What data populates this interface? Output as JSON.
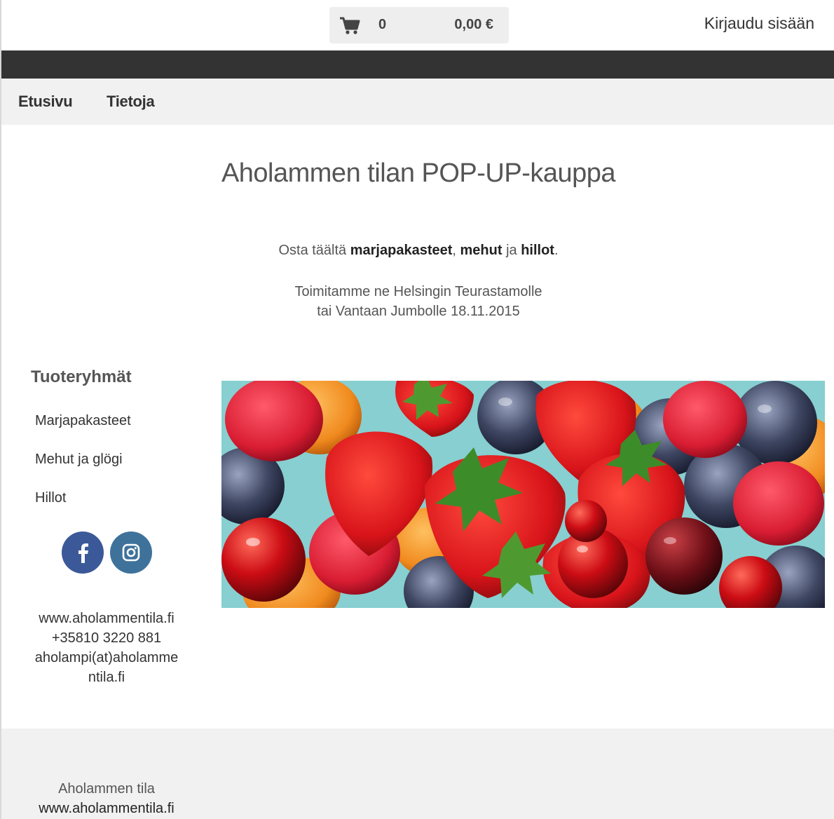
{
  "header": {
    "cart": {
      "icon": "shopping-cart-icon",
      "count": "0",
      "total": "0,00 €"
    },
    "login_label": "Kirjaudu sisään"
  },
  "nav": {
    "items": [
      {
        "label": "Etusivu"
      },
      {
        "label": "Tietoja"
      }
    ]
  },
  "main": {
    "title": "Aholammen tilan POP-UP-kauppa",
    "intro": {
      "prefix": "Osta täältä ",
      "item1": "marjapakasteet",
      "sep1": ", ",
      "item2": "mehut",
      "sep2": " ja ",
      "item3": "hillot",
      "suffix": "."
    },
    "delivery_line1": "Toimitamme ne Helsingin Teurastamolle",
    "delivery_line2": "tai Vantaan Jumbolle 18.11.2015"
  },
  "sidebar": {
    "heading": "Tuoteryhmät",
    "categories": [
      {
        "label": "Marjapakasteet"
      },
      {
        "label": "Mehut ja glögi"
      },
      {
        "label": "Hillot"
      }
    ],
    "social": [
      {
        "icon": "facebook-icon",
        "color": "#3b5998"
      },
      {
        "icon": "instagram-icon",
        "color": "#3f729b"
      }
    ],
    "contact": {
      "website": "www.aholammentila.fi",
      "phone": "+35810 3220 881",
      "email_line1": "aholampi(at)aholamme",
      "email_line2": "ntila.fi"
    }
  },
  "footer": {
    "name": "Aholammen tila",
    "website": "www.aholammentila.fi"
  },
  "colors": {
    "dark_band": "#333333",
    "nav_bg": "#f1f1f1",
    "banner_bg": "#87cfd0"
  }
}
